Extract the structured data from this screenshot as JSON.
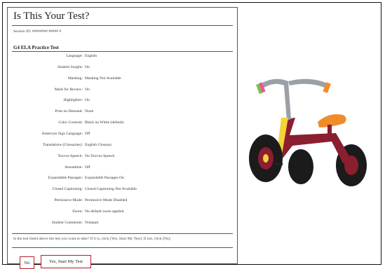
{
  "dialog": {
    "title": "Is This Your Test?",
    "session": "Session ID: ######## ##### #",
    "test_name": "G4 ELA Practice Test",
    "settings": [
      {
        "label": "Language:",
        "value": "English"
      },
      {
        "label": "Student Sought:",
        "value": "On"
      },
      {
        "label": "Masking:",
        "value": "Masking Not Available"
      },
      {
        "label": "Mark for Review:",
        "value": "On"
      },
      {
        "label": "Highlighter:",
        "value": "On"
      },
      {
        "label": "Print on Demand:",
        "value": "None"
      },
      {
        "label": "Color Contrast:",
        "value": "Black on White (default)"
      },
      {
        "label": "American Sign Language:",
        "value": "Off"
      },
      {
        "label": "Translations (Glossaries):",
        "value": "English Glossary"
      },
      {
        "label": "Text-to-Speech:",
        "value": "No Text-to-Speech"
      },
      {
        "label": "Streamline:",
        "value": "Off"
      },
      {
        "label": "Expandable Passages:",
        "value": "Expandable Passages On"
      },
      {
        "label": "Closed Captioning:",
        "value": "Closed Captioning Not Available"
      },
      {
        "label": "Permissive Mode:",
        "value": "Permissive Mode Disabled"
      },
      {
        "label": "Zoom:",
        "value": "No default zoom applied"
      },
      {
        "label": "Student Comments:",
        "value": "Notepad"
      }
    ],
    "question": "Is the test listed above the test you want to take? If it is, click [Yes, Start My Test]. If not, click [No].",
    "buttons": {
      "no": "No",
      "yes": "Yes, Start My Test"
    }
  },
  "illustration": {
    "icon": "tricycle-icon",
    "colors": {
      "frame": "#8b1e2f",
      "fork": "#f4d23a",
      "seat": "#f08c2a",
      "handlebar": "#9aa0a6",
      "grip_green": "#7bc142",
      "grip_pink": "#e6579a",
      "grip_orange": "#f08c2a",
      "tire": "#1b1b1b"
    }
  },
  "accent": "#2f6a52",
  "button_border": "#b51d2a"
}
